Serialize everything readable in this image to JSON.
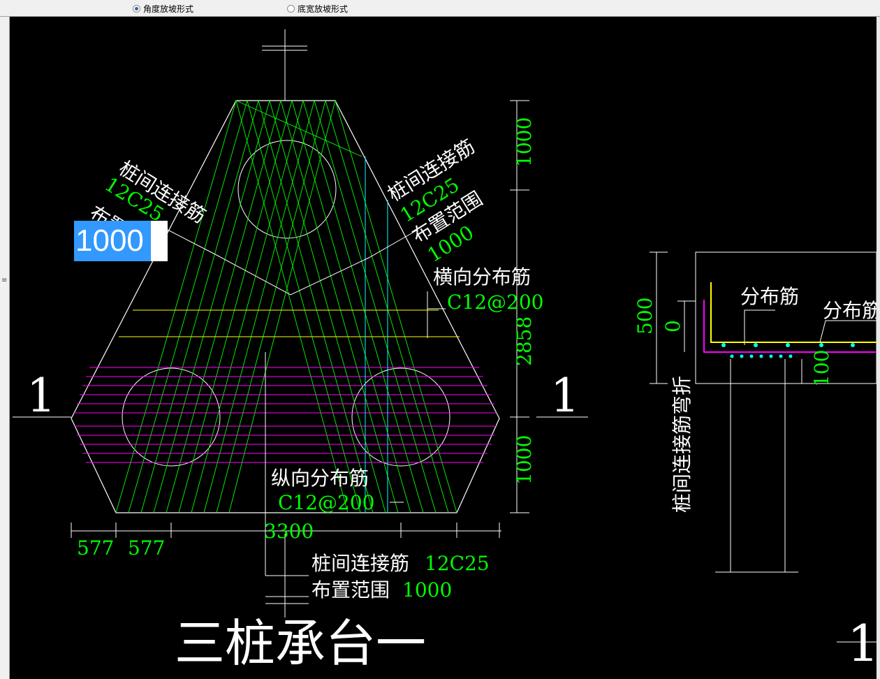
{
  "toolbar": {
    "option_angle": "角度放坡形式",
    "option_width": "底宽放坡形式"
  },
  "plan": {
    "label_tl_1": "桩间连接筋",
    "label_tl_2": "12C25",
    "label_tl_3": "布置",
    "edit_value": "1000",
    "label_tr_1": "桩间连接筋",
    "label_tr_2": "12C25",
    "label_tr_3": "布置范围",
    "label_tr_4": "1000",
    "horiz_dist": "横向分布筋",
    "horiz_dist_spec": "C12@200",
    "long_dist": "纵向分布筋",
    "long_dist_spec": "C12@200",
    "bottom_label_1": "桩间连接筋",
    "bottom_label_1_spec": "12C25",
    "bottom_label_2": "布置范围",
    "bottom_label_2_spec": "1000",
    "dim_top": "1000",
    "dim_mid": "2858",
    "dim_bot": "1000",
    "dim_b1": "577",
    "dim_b2": "577",
    "dim_b3": "3300",
    "section_left": "1",
    "section_right": "1",
    "title": "三桩承台一"
  },
  "section": {
    "dim_500": "500",
    "dim_0": "0",
    "dim_100": "100",
    "label_dist_1": "分布筋",
    "label_dist_2": "分布筋",
    "vertical_label": "桩间连接筋弯折",
    "title_partial": "1-"
  },
  "colors": {
    "green": "#00ff00",
    "white": "#ffffff",
    "magenta": "#ff00ff",
    "yellow": "#ffff00",
    "cyan": "#00ffff",
    "selection": "#3399ff"
  }
}
